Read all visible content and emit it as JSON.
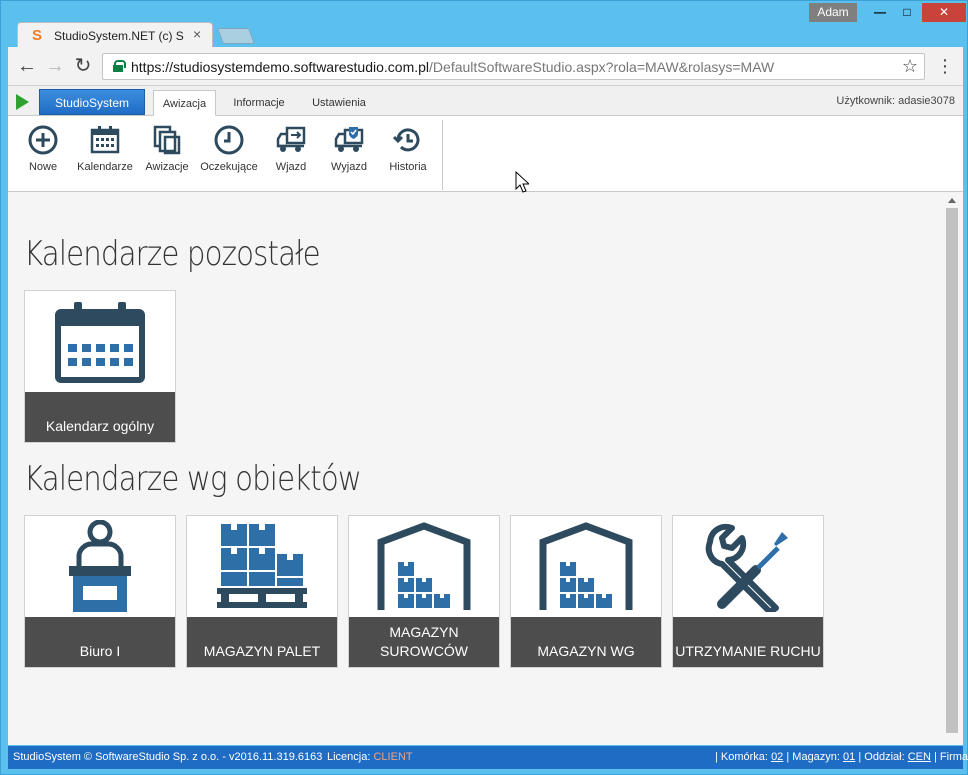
{
  "window": {
    "user_badge": "Adam",
    "min_glyph": "—",
    "max_glyph": "□",
    "close_glyph": "✕"
  },
  "browser": {
    "tab_title": "StudioSystem.NET (c) Sof",
    "tab_favicon": "S",
    "tab_close": "×",
    "back_glyph": "←",
    "fwd_glyph": "→",
    "reload_glyph": "↻",
    "url_host": "https://studiosystemdemo.softwarestudio.com.pl",
    "url_path": "/DefaultSoftwareStudio.aspx?rola=MAW&rolasys=MAW",
    "star_glyph": "☆",
    "menu_glyph": "⋮"
  },
  "app_header": {
    "studio_button": "StudioSystem",
    "tabs": [
      {
        "label": "Awizacja",
        "active": true
      },
      {
        "label": "Informacje",
        "active": false
      },
      {
        "label": "Ustawienia",
        "active": false
      }
    ],
    "user": "Użytkownik: adasie3078"
  },
  "ribbon": {
    "buttons": [
      {
        "label": "Nowe",
        "icon": "plus-circle-icon"
      },
      {
        "label": "Kalendarze",
        "icon": "calendar-icon"
      },
      {
        "label": "Awizacje",
        "icon": "documents-icon"
      },
      {
        "label": "Oczekujące",
        "icon": "clock-icon"
      },
      {
        "label": "Wjazd",
        "icon": "truck-in-icon"
      },
      {
        "label": "Wyjazd",
        "icon": "truck-out-icon"
      },
      {
        "label": "Historia",
        "icon": "history-icon"
      }
    ]
  },
  "content": {
    "section1_title": "Kalendarze pozostałe",
    "section1_tiles": [
      {
        "label": "Kalendarz ogólny",
        "icon": "calendar-icon"
      }
    ],
    "section2_title": "Kalendarze wg obiektów",
    "section2_tiles": [
      {
        "label": "Biuro I",
        "icon": "office-desk-icon"
      },
      {
        "label": "MAGAZYN PALET",
        "icon": "pallet-boxes-icon"
      },
      {
        "label": "MAGAZYN SUROWCÓW",
        "icon": "warehouse-icon"
      },
      {
        "label": "MAGAZYN WG",
        "icon": "warehouse-icon"
      },
      {
        "label": "UTRZYMANIE RUCHU",
        "icon": "wrench-screwdriver-icon"
      }
    ]
  },
  "statusbar": {
    "copyright": "StudioSystem © SoftwareStudio Sp. z o.o. - v2016.11.319.6163",
    "license_label": "Licencja:",
    "license_value": "CLIENT",
    "cell_label": "| Komórka:",
    "cell_value": "02",
    "warehouse_label": "| Magazyn:",
    "warehouse_value": "01",
    "branch_label": "| Oddział:",
    "branch_value": "CEN",
    "company_label": "| Firma:"
  },
  "colors": {
    "accent": "#1f6cc4",
    "icon_dark": "#2d4a5e",
    "icon_blue": "#2f6fa8",
    "tile_label_bg": "#4d4d4d",
    "license_value": "#f3a37c"
  }
}
